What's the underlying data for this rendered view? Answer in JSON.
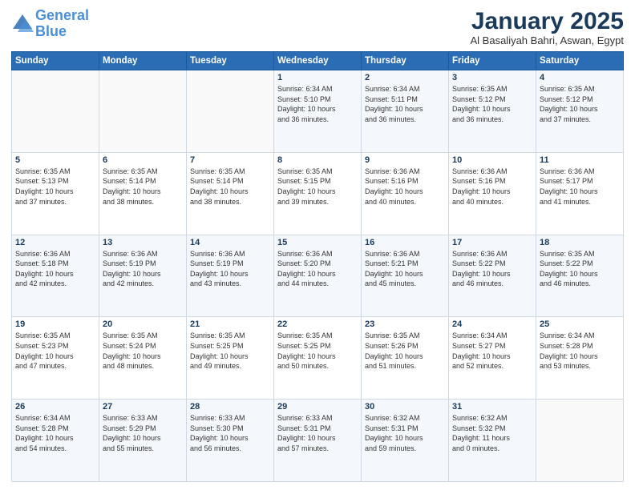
{
  "header": {
    "logo_line1": "General",
    "logo_line2": "Blue",
    "month": "January 2025",
    "location": "Al Basaliyah Bahri, Aswan, Egypt"
  },
  "days_of_week": [
    "Sunday",
    "Monday",
    "Tuesday",
    "Wednesday",
    "Thursday",
    "Friday",
    "Saturday"
  ],
  "weeks": [
    [
      {
        "num": "",
        "info": ""
      },
      {
        "num": "",
        "info": ""
      },
      {
        "num": "",
        "info": ""
      },
      {
        "num": "1",
        "info": "Sunrise: 6:34 AM\nSunset: 5:10 PM\nDaylight: 10 hours\nand 36 minutes."
      },
      {
        "num": "2",
        "info": "Sunrise: 6:34 AM\nSunset: 5:11 PM\nDaylight: 10 hours\nand 36 minutes."
      },
      {
        "num": "3",
        "info": "Sunrise: 6:35 AM\nSunset: 5:12 PM\nDaylight: 10 hours\nand 36 minutes."
      },
      {
        "num": "4",
        "info": "Sunrise: 6:35 AM\nSunset: 5:12 PM\nDaylight: 10 hours\nand 37 minutes."
      }
    ],
    [
      {
        "num": "5",
        "info": "Sunrise: 6:35 AM\nSunset: 5:13 PM\nDaylight: 10 hours\nand 37 minutes."
      },
      {
        "num": "6",
        "info": "Sunrise: 6:35 AM\nSunset: 5:14 PM\nDaylight: 10 hours\nand 38 minutes."
      },
      {
        "num": "7",
        "info": "Sunrise: 6:35 AM\nSunset: 5:14 PM\nDaylight: 10 hours\nand 38 minutes."
      },
      {
        "num": "8",
        "info": "Sunrise: 6:35 AM\nSunset: 5:15 PM\nDaylight: 10 hours\nand 39 minutes."
      },
      {
        "num": "9",
        "info": "Sunrise: 6:36 AM\nSunset: 5:16 PM\nDaylight: 10 hours\nand 40 minutes."
      },
      {
        "num": "10",
        "info": "Sunrise: 6:36 AM\nSunset: 5:16 PM\nDaylight: 10 hours\nand 40 minutes."
      },
      {
        "num": "11",
        "info": "Sunrise: 6:36 AM\nSunset: 5:17 PM\nDaylight: 10 hours\nand 41 minutes."
      }
    ],
    [
      {
        "num": "12",
        "info": "Sunrise: 6:36 AM\nSunset: 5:18 PM\nDaylight: 10 hours\nand 42 minutes."
      },
      {
        "num": "13",
        "info": "Sunrise: 6:36 AM\nSunset: 5:19 PM\nDaylight: 10 hours\nand 42 minutes."
      },
      {
        "num": "14",
        "info": "Sunrise: 6:36 AM\nSunset: 5:19 PM\nDaylight: 10 hours\nand 43 minutes."
      },
      {
        "num": "15",
        "info": "Sunrise: 6:36 AM\nSunset: 5:20 PM\nDaylight: 10 hours\nand 44 minutes."
      },
      {
        "num": "16",
        "info": "Sunrise: 6:36 AM\nSunset: 5:21 PM\nDaylight: 10 hours\nand 45 minutes."
      },
      {
        "num": "17",
        "info": "Sunrise: 6:36 AM\nSunset: 5:22 PM\nDaylight: 10 hours\nand 46 minutes."
      },
      {
        "num": "18",
        "info": "Sunrise: 6:35 AM\nSunset: 5:22 PM\nDaylight: 10 hours\nand 46 minutes."
      }
    ],
    [
      {
        "num": "19",
        "info": "Sunrise: 6:35 AM\nSunset: 5:23 PM\nDaylight: 10 hours\nand 47 minutes."
      },
      {
        "num": "20",
        "info": "Sunrise: 6:35 AM\nSunset: 5:24 PM\nDaylight: 10 hours\nand 48 minutes."
      },
      {
        "num": "21",
        "info": "Sunrise: 6:35 AM\nSunset: 5:25 PM\nDaylight: 10 hours\nand 49 minutes."
      },
      {
        "num": "22",
        "info": "Sunrise: 6:35 AM\nSunset: 5:25 PM\nDaylight: 10 hours\nand 50 minutes."
      },
      {
        "num": "23",
        "info": "Sunrise: 6:35 AM\nSunset: 5:26 PM\nDaylight: 10 hours\nand 51 minutes."
      },
      {
        "num": "24",
        "info": "Sunrise: 6:34 AM\nSunset: 5:27 PM\nDaylight: 10 hours\nand 52 minutes."
      },
      {
        "num": "25",
        "info": "Sunrise: 6:34 AM\nSunset: 5:28 PM\nDaylight: 10 hours\nand 53 minutes."
      }
    ],
    [
      {
        "num": "26",
        "info": "Sunrise: 6:34 AM\nSunset: 5:28 PM\nDaylight: 10 hours\nand 54 minutes."
      },
      {
        "num": "27",
        "info": "Sunrise: 6:33 AM\nSunset: 5:29 PM\nDaylight: 10 hours\nand 55 minutes."
      },
      {
        "num": "28",
        "info": "Sunrise: 6:33 AM\nSunset: 5:30 PM\nDaylight: 10 hours\nand 56 minutes."
      },
      {
        "num": "29",
        "info": "Sunrise: 6:33 AM\nSunset: 5:31 PM\nDaylight: 10 hours\nand 57 minutes."
      },
      {
        "num": "30",
        "info": "Sunrise: 6:32 AM\nSunset: 5:31 PM\nDaylight: 10 hours\nand 59 minutes."
      },
      {
        "num": "31",
        "info": "Sunrise: 6:32 AM\nSunset: 5:32 PM\nDaylight: 11 hours\nand 0 minutes."
      },
      {
        "num": "",
        "info": ""
      }
    ]
  ]
}
